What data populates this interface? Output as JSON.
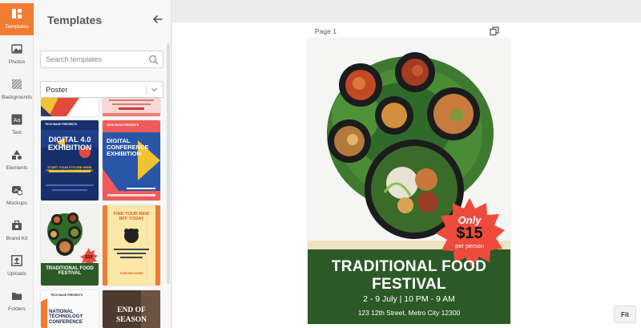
{
  "rail": {
    "items": [
      {
        "label": "Templates",
        "icon": "templates-icon",
        "active": true
      },
      {
        "label": "Photos",
        "icon": "photo-icon"
      },
      {
        "label": "Backgrounds",
        "icon": "backgrounds-icon"
      },
      {
        "label": "Text",
        "icon": "text-icon"
      },
      {
        "label": "Elements",
        "icon": "elements-icon"
      },
      {
        "label": "Mockups",
        "icon": "mockups-icon"
      },
      {
        "label": "Brand Kit",
        "icon": "brand-kit-icon"
      },
      {
        "label": "Uploads",
        "icon": "uploads-icon"
      },
      {
        "label": "Folders",
        "icon": "folder-icon"
      }
    ],
    "text_icon_glyph": "Aa"
  },
  "panel": {
    "title": "Templates",
    "search_placeholder": "Search templates",
    "category": "Poster"
  },
  "thumbnails": [
    {
      "title": "DIGITAL 4.0 EXHIBITION",
      "kicker": "TECH BASE PRESENTS",
      "sub": "START YOUR FUTURE HERE FROM 09.02.2023 FREE ENTRY"
    },
    {
      "title": "DIGITAL CONFERENCE EXHIBITION",
      "kicker": "TECH BASE PRESENTS"
    },
    {
      "title": "TRADITIONAL FOOD FESTIVAL",
      "price": "$15"
    },
    {
      "title": "FIND YOUR NEW BFF TODAY",
      "sub": "TAKE HIM HOME!"
    },
    {
      "title": "NATIONAL TECHNOLOGY CONFERENCE",
      "kicker": "TECH BASE PRESENTS"
    },
    {
      "title": "END OF SEASON"
    }
  ],
  "canvas": {
    "page_label": "Page 1",
    "fit_label": "Fit"
  },
  "poster": {
    "title_line1": "TRADITIONAL FOOD",
    "title_line2": "FESTIVAL",
    "date": "2 - 9 July  |  10 PM - 9 AM",
    "address": "123 12th Street, Metro City 12300",
    "badge_only": "Only",
    "badge_price": "$15",
    "badge_per": "per person"
  },
  "colors": {
    "accent": "#f07c34",
    "poster_green": "#2c5a27",
    "badge_red": "#ef4b3c"
  }
}
